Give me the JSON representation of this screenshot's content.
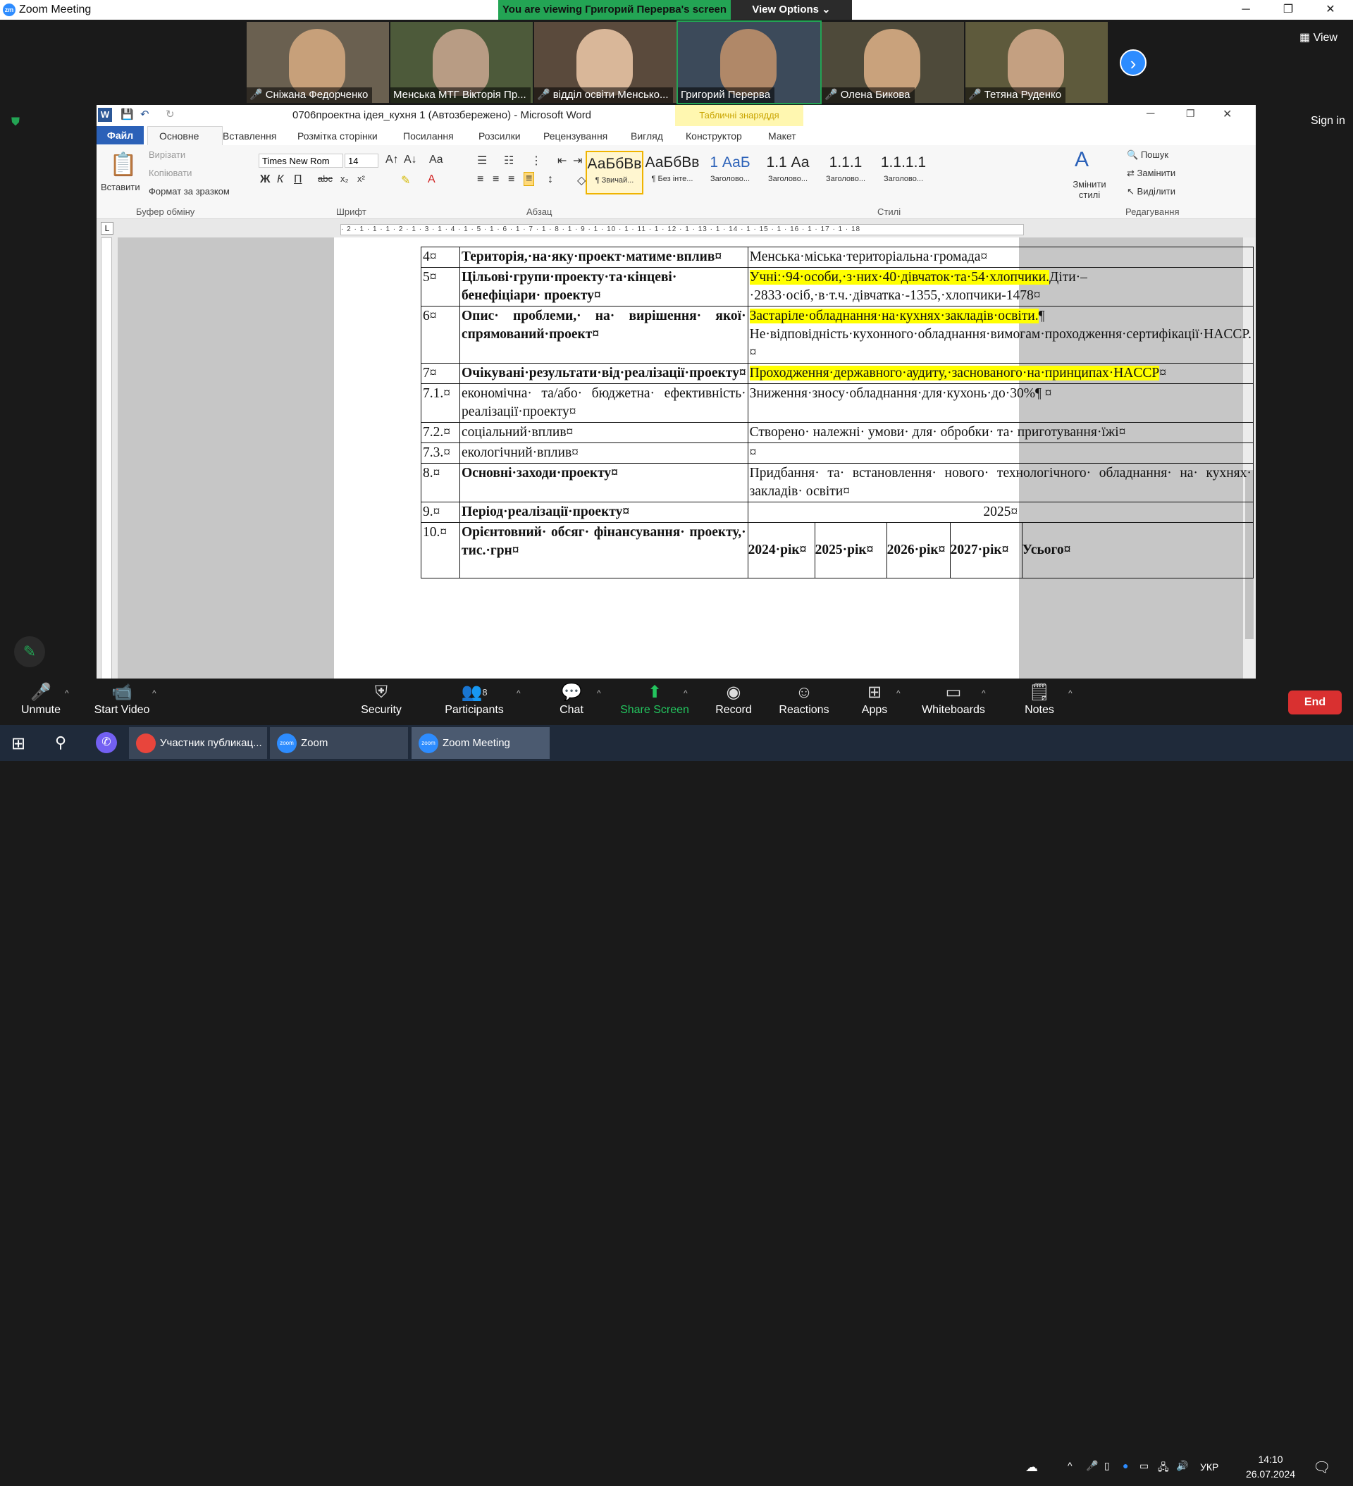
{
  "app": {
    "title": "Zoom Meeting",
    "logo": "zm"
  },
  "share_banner": {
    "text": "You are viewing Григорий Перерва's screen",
    "view_options": "View Options"
  },
  "gallery": [
    {
      "name": "Сніжана Федорченко",
      "muted": true,
      "bg": "#6a6050",
      "face": "#c7a07a"
    },
    {
      "name": "Менська МТГ Вікторія Пр...",
      "muted": false,
      "bg": "#4d5a3a",
      "face": "#b89c84"
    },
    {
      "name": "відділ освіти Менсько...",
      "muted": true,
      "bg": "#5a4a3c",
      "face": "#d9b799"
    },
    {
      "name": "Григорий Перерва",
      "muted": false,
      "bg": "#3c4a5a",
      "face": "#b08868"
    },
    {
      "name": "Олена Бикова",
      "muted": true,
      "bg": "#4e4a3a",
      "face": "#c9a27c"
    },
    {
      "name": "Тетяна Руденко",
      "muted": true,
      "bg": "#5e5a3c",
      "face": "#c4a081"
    }
  ],
  "view_button": "View",
  "sign_in": "Sign in",
  "word": {
    "doc_title": "0706проектна ідея_кухня 1 (Автозбережено)  -  Microsoft Word",
    "table_tools": "Табличні знаряддя",
    "tabs": [
      "Файл",
      "Основне",
      "Вставлення",
      "Розмітка сторінки",
      "Посилання",
      "Розсилки",
      "Рецензування",
      "Вигляд",
      "Конструктор",
      "Макет"
    ],
    "ribbon": {
      "paste": "Вставити",
      "cut": "Вирізати",
      "copy": "Копіювати",
      "format_painter": "Формат за зразком",
      "clipboard": "Буфер обміну",
      "font_name": "Times New Rom",
      "font_size": "14",
      "font_group": "Шрифт",
      "paragraph_group": "Абзац",
      "styles_group": "Стилі",
      "styles": [
        {
          "preview": "АаБбВв",
          "name": "¶ Звичай..."
        },
        {
          "preview": "АаБбВв",
          "name": "¶ Без інте..."
        },
        {
          "preview": "1  АаБ",
          "name": "Заголово..."
        },
        {
          "preview": "1.1  Аа",
          "name": "Заголово..."
        },
        {
          "preview": "1.1.1  ",
          "name": "Заголово..."
        },
        {
          "preview": "1.1.1.1",
          "name": "Заголово..."
        }
      ],
      "change_styles": "Змінити стилі",
      "find": "Пошук",
      "replace": "Замінити",
      "select": "Виділити",
      "editing_group": "Редагування"
    },
    "ruler_text": "· 2 · 1 · 1 · 1 · 2 · 1 · 3 · 1 · 4 · 1 · 5 · 1 · 6 · 1 · 7 · 1 · 8 · 1 · 9 · 1 · 10 · 1 · 11 · 1 · 12 · 1 · 13 · 1 · 14 · 1 · 15 · 1 · 16 · 1 · 17 · 1 · 18"
  },
  "table": {
    "rows": [
      {
        "num": "4¤",
        "label": "Територія,·на·яку·проект·матиме·вплив¤",
        "label_bold": true,
        "value": "Менська·міська·територіальна·громада¤",
        "hl": ""
      },
      {
        "num": "5¤",
        "label": "Цільові·групи·проекту·та·кінцеві· бенефіціари· проекту¤",
        "label_bold": true,
        "hl": "Учні:·94·особи,·з·них·40·дівчаток·та·54·хлопчики.",
        "value": "Діти·–·2833·осіб,·в·т.ч.·дівчатка·-1355,·хлопчики-1478¤"
      },
      {
        "num": "6¤",
        "label": "Опис· проблеми,· на· вирішення· якої· спрямований·проект¤",
        "label_bold": true,
        "hl": "Застаріле·обладнання·на·кухнях·закладів·освіти.",
        "value": "¶ Не·відповідність·кухонного·обладнання·вимогам·проходження·сертифікації·HACCP.¤"
      },
      {
        "num": "7¤",
        "label": "Очікувані·результати·від·реалізації·проекту¤",
        "label_bold": true,
        "hl": "Проходження·державного·аудиту,·заснованого·на·принципах·HACCP",
        "value": "¤"
      },
      {
        "num": "7.1.¤",
        "label": "економічна· та/або· бюджетна· ефективність· реалізації·проекту¤",
        "label_bold": false,
        "hl": "",
        "value": "Зниження·зносу·обладнання·для·кухонь·до·30%¶ ¤"
      },
      {
        "num": "7.2.¤",
        "label": "соціальний·вплив¤",
        "label_bold": false,
        "hl": "",
        "value": "Створено· належні· умови· для· обробки· та· приготування·їжі¤"
      },
      {
        "num": "7.3.¤",
        "label": "екологічний·вплив¤",
        "label_bold": false,
        "hl": "",
        "value": "¤"
      },
      {
        "num": "8.¤",
        "label": "Основні·заходи·проекту¤",
        "label_bold": true,
        "hl": "",
        "value": "Придбання· та· встановлення· нового· технологічного· обладнання· на· кухнях· закладів· освіти¤"
      },
      {
        "num": "9.¤",
        "label": "Період·реалізації·проекту¤",
        "label_bold": true,
        "hl": "",
        "value": "2025¤"
      },
      {
        "num": "10.¤",
        "label": "Орієнтовний· обсяг· фінансування· проекту,· тис.·грн¤",
        "label_bold": true,
        "hl": "",
        "value": ""
      }
    ],
    "fin_headers": [
      "2024·рік¤",
      "2025·рік¤",
      "2026·рік¤",
      "2027·рік¤",
      "Усього¤"
    ]
  },
  "toolbar": {
    "unmute": "Unmute",
    "start_video": "Start Video",
    "security": "Security",
    "participants": "Participants",
    "participants_count": "8",
    "chat": "Chat",
    "share_screen": "Share Screen",
    "record": "Record",
    "reactions": "Reactions",
    "apps": "Apps",
    "whiteboards": "Whiteboards",
    "notes": "Notes",
    "end": "End"
  },
  "taskbar": {
    "items": [
      "Участник публикац...",
      "Zoom",
      "Zoom Meeting"
    ],
    "lang": "УКР",
    "time": "14:10",
    "date": "26.07.2024"
  }
}
